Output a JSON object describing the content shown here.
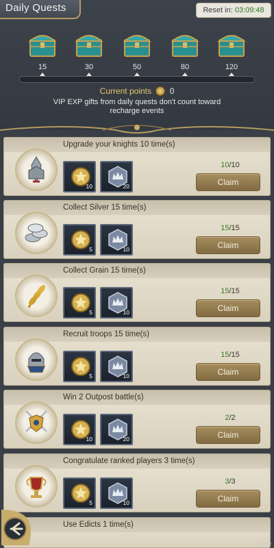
{
  "header": {
    "title": "Daily Quests",
    "reset_label": "Reset in:",
    "reset_time": "03:09:48"
  },
  "chests": [
    {
      "label": "15",
      "icon": "treasure-chest-icon"
    },
    {
      "label": "30",
      "icon": "treasure-chest-icon"
    },
    {
      "label": "50",
      "icon": "treasure-chest-icon"
    },
    {
      "label": "80",
      "icon": "treasure-chest-icon"
    },
    {
      "label": "120",
      "icon": "treasure-chest-icon"
    }
  ],
  "points": {
    "label": "Current points",
    "value": "0",
    "icon": "points-coin-icon",
    "progress_fraction": 0
  },
  "vip_note": "VIP EXP gifts from daily quests don't count toward recharge events",
  "quests": [
    {
      "title": "Upgrade your knights 10 time(s)",
      "icon": "knight-armor-icon",
      "rewards": [
        "10",
        "20"
      ],
      "progress_done": "10",
      "progress_total": "/10",
      "claim_label": "Claim"
    },
    {
      "title": "Collect Silver 15 time(s)",
      "icon": "silver-coins-icon",
      "rewards": [
        "5",
        "10"
      ],
      "progress_done": "15",
      "progress_total": "/15",
      "claim_label": "Claim"
    },
    {
      "title": "Collect Grain 15 time(s)",
      "icon": "grain-wheat-icon",
      "rewards": [
        "5",
        "10"
      ],
      "progress_done": "15",
      "progress_total": "/15",
      "claim_label": "Claim"
    },
    {
      "title": "Recruit troops 15 time(s)",
      "icon": "soldier-helmet-icon",
      "rewards": [
        "5",
        "10"
      ],
      "progress_done": "15",
      "progress_total": "/15",
      "claim_label": "Claim"
    },
    {
      "title": "Win 2 Outpost battle(s)",
      "icon": "crossed-swords-shield-icon",
      "rewards": [
        "10",
        "20"
      ],
      "progress_done": "2",
      "progress_total": "/2",
      "claim_label": "Claim"
    },
    {
      "title": "Congratulate ranked players 3 time(s)",
      "icon": "trophy-cup-icon",
      "rewards": [
        "5",
        "10"
      ],
      "progress_done": "3",
      "progress_total": "/3",
      "claim_label": "Claim"
    }
  ],
  "partial_quest": {
    "title": "Use Edicts 1 time(s)"
  },
  "reward_icons": [
    "gold-star-medal-icon",
    "silver-crown-badge-icon"
  ],
  "footer": {
    "corner_mark": "game"
  },
  "colors": {
    "claim": "#957a4f",
    "complete": "#2f7f1f",
    "points": "#e9c86a"
  }
}
